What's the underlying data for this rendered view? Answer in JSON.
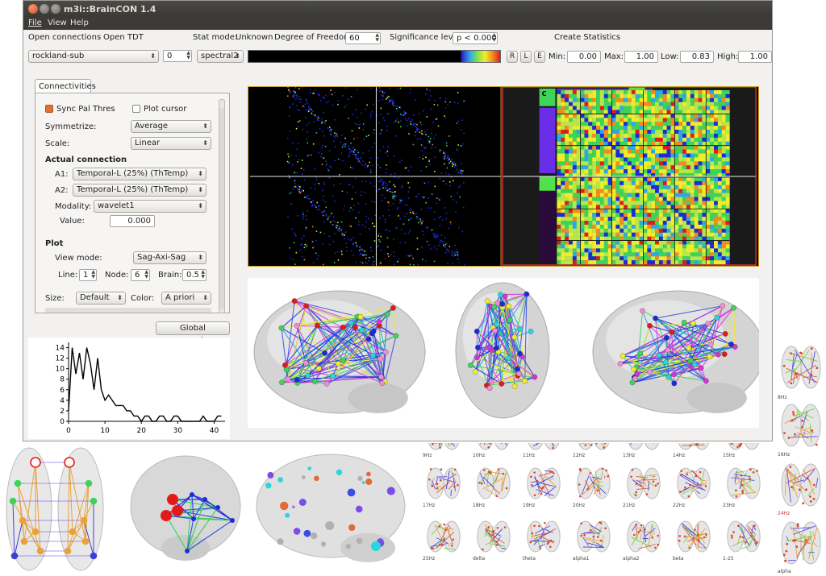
{
  "window": {
    "title": "m3i::BrainCON 1.4",
    "title_buttons": [
      "close",
      "minimize",
      "maximize"
    ]
  },
  "menu": [
    "File",
    "View",
    "Help"
  ],
  "toolbar1": {
    "open_connections": "Open connections",
    "open_tdt": "Open TDT",
    "stat_mode_label": "Stat mode:",
    "stat_mode_value": "Unknown",
    "dof_label": "Degree of Freedom:",
    "dof_value": "60",
    "significance_label": "Significance level:",
    "significance_value": "p < 0.000",
    "create_statistics": "Create Statistics"
  },
  "toolbar2": {
    "dataset": "rockland-sub",
    "index": "0",
    "palette": "spectral2",
    "view_buttons": [
      "R",
      "L",
      "E"
    ],
    "min_label": "Min:",
    "min_value": "0.00",
    "max_label": "Max:",
    "max_value": "1.00",
    "low_label": "Low:",
    "low_value": "0.83",
    "high_label": "High:",
    "high_value": "1.00"
  },
  "panel": {
    "tab": "Connectivities",
    "sync_pal_thres": "Sync Pal Thres",
    "plot_cursor": "Plot cursor",
    "symmetrize_label": "Symmetrize:",
    "symmetrize_value": "Average",
    "scale_label": "Scale:",
    "scale_value": "Linear",
    "actual_connection": "Actual connection",
    "a1_label": "A1:",
    "a1_value": "Temporal-L (25%) (ThTemp)",
    "a2_label": "A2:",
    "a2_value": "Temporal-L (25%) (ThTemp)",
    "modality_label": "Modality:",
    "modality_value": "wavelet1",
    "value_label": "Value:",
    "value_value": "0.000",
    "plot_heading": "Plot",
    "view_mode_label": "View mode:",
    "view_mode_value": "Sag-Axi-Sag",
    "line_label": "Line:",
    "line_value": "1",
    "node_label": "Node:",
    "node_value": "6",
    "brain_label": "Brain:",
    "brain_value": "0.5",
    "size_label": "Size:",
    "size_value": "Default",
    "color_label": "Color:",
    "color_value": "A priori",
    "global_parameters": "Global parameters"
  },
  "histogram": {
    "y_ticks": [
      "14",
      "12",
      "10",
      "8",
      "6",
      "4",
      "2",
      "0"
    ],
    "x_ticks": [
      "0",
      "10",
      "20",
      "30",
      "40"
    ],
    "values": [
      2,
      14,
      9,
      13,
      8,
      14,
      11,
      6,
      12,
      6,
      4,
      5,
      4,
      3,
      3,
      3,
      2,
      2,
      1,
      1,
      0,
      1,
      1,
      0,
      0,
      1,
      1,
      0,
      0,
      1,
      1,
      0,
      0,
      0,
      0,
      0,
      0,
      1,
      0,
      0,
      0,
      1,
      1
    ],
    "xlim": [
      0,
      43
    ],
    "ylim": [
      0,
      15
    ]
  },
  "matrix": {
    "corner_label": "C"
  },
  "freq_grid": {
    "right_column": [
      "8Hz",
      "16Hz",
      "24Hz",
      "alpha"
    ],
    "row1": [
      "9Hz",
      "10Hz",
      "11Hz",
      "12Hz",
      "13Hz",
      "14Hz",
      "15Hz"
    ],
    "row2": [
      "17Hz",
      "18Hz",
      "19Hz",
      "20Hz",
      "21Hz",
      "22Hz",
      "23Hz"
    ],
    "row3": [
      "25Hz",
      "delta",
      "theta",
      "alpha1",
      "alpha2",
      "beta",
      "1-25"
    ]
  },
  "colors": {
    "title_bar": "#3c3b37",
    "checkbox_on": "#e2702e",
    "matrix_border": "#c9a227",
    "highlight_label": "#c33333"
  }
}
